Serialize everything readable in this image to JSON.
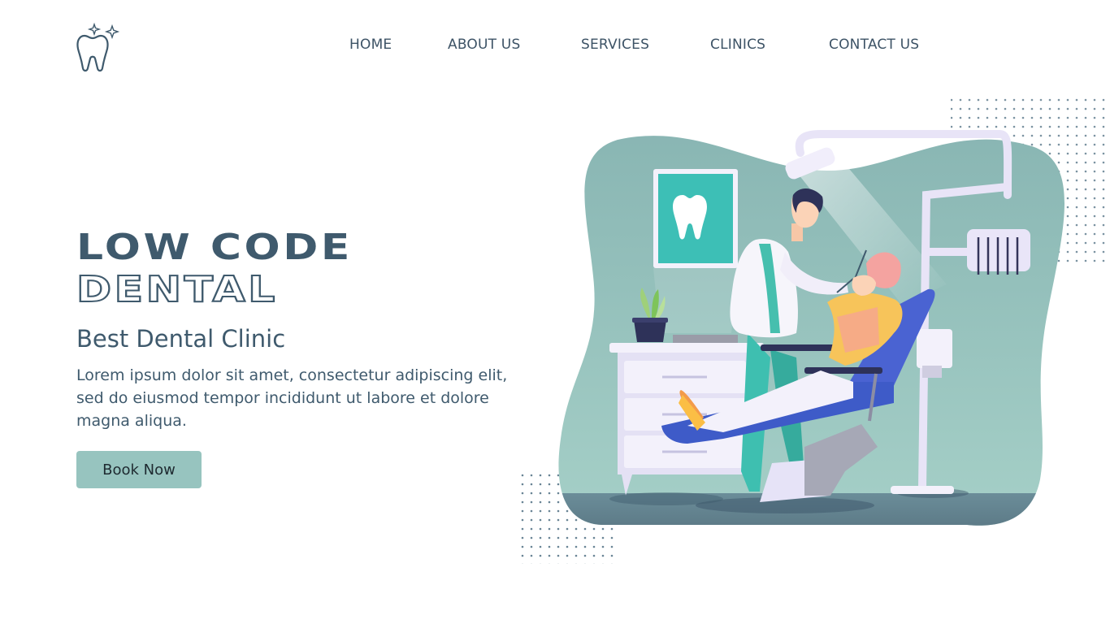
{
  "brand": {
    "logo_icon": "tooth-sparkle-icon"
  },
  "nav": {
    "items": [
      "HOME",
      "ABOUT US",
      "SERVICES",
      "CLINICS",
      "CONTACT US"
    ]
  },
  "hero": {
    "title_line1": "LOW CODE",
    "title_line2": "DENTAL",
    "subtitle": "Best Dental Clinic",
    "description": "Lorem ipsum dolor sit amet, consectetur adipiscing elit, sed do eiusmod tempor incididunt ut labore et dolore magna aliqua.",
    "cta_label": "Book Now"
  },
  "colors": {
    "text": "#3f5a6d",
    "accent": "#97c4bf",
    "blob": "#8bb7b4",
    "chair": "#3e5bc8"
  },
  "illustration": {
    "icons": [
      "dentist-illustration",
      "tooth-poster-icon",
      "dental-chair-icon",
      "plant-icon",
      "dental-lamp-icon"
    ]
  }
}
